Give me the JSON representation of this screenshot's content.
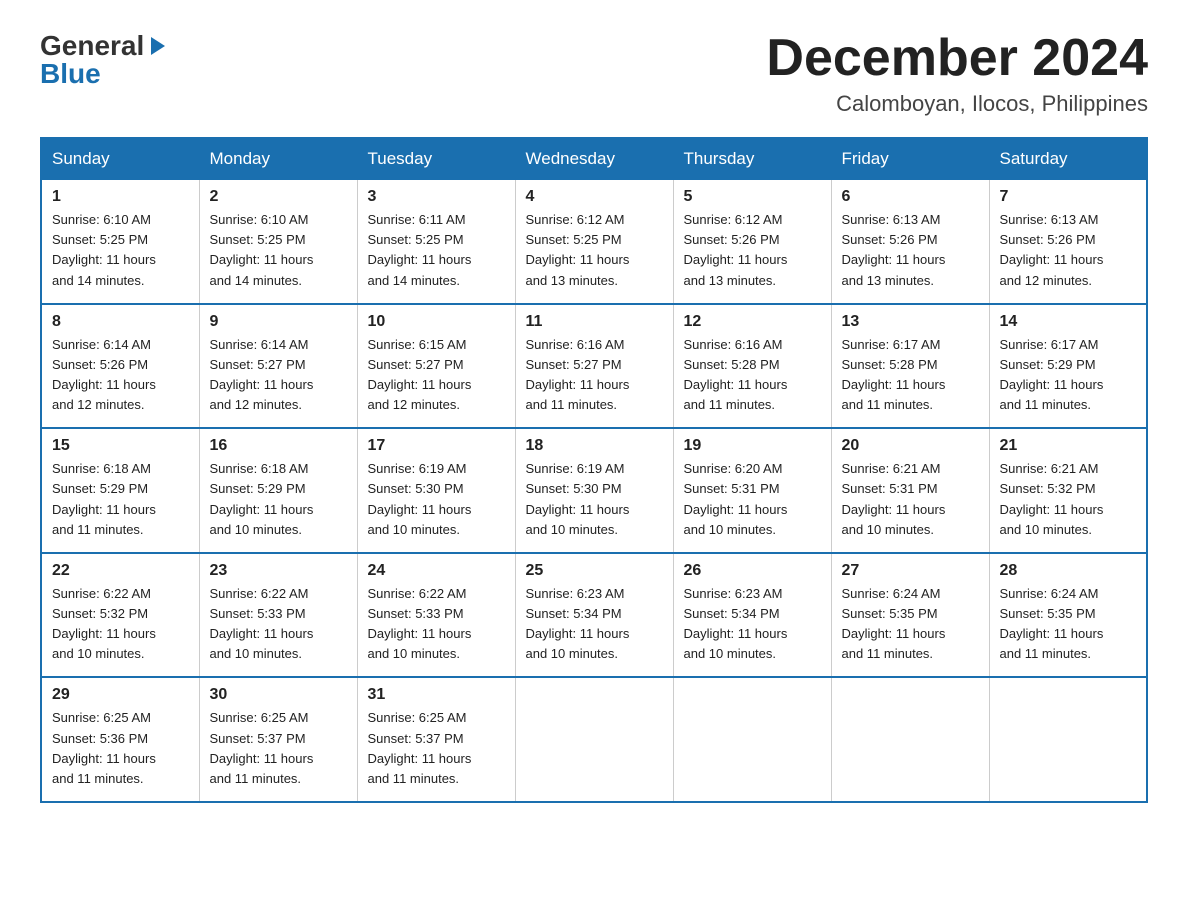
{
  "header": {
    "logo": {
      "general": "General",
      "arrow": "▶",
      "blue": "Blue"
    },
    "title": "December 2024",
    "location": "Calomboyan, Ilocos, Philippines"
  },
  "calendar": {
    "days_of_week": [
      "Sunday",
      "Monday",
      "Tuesday",
      "Wednesday",
      "Thursday",
      "Friday",
      "Saturday"
    ],
    "weeks": [
      [
        {
          "day": "1",
          "sunrise": "6:10 AM",
          "sunset": "5:25 PM",
          "daylight": "11 hours and 14 minutes."
        },
        {
          "day": "2",
          "sunrise": "6:10 AM",
          "sunset": "5:25 PM",
          "daylight": "11 hours and 14 minutes."
        },
        {
          "day": "3",
          "sunrise": "6:11 AM",
          "sunset": "5:25 PM",
          "daylight": "11 hours and 14 minutes."
        },
        {
          "day": "4",
          "sunrise": "6:12 AM",
          "sunset": "5:25 PM",
          "daylight": "11 hours and 13 minutes."
        },
        {
          "day": "5",
          "sunrise": "6:12 AM",
          "sunset": "5:26 PM",
          "daylight": "11 hours and 13 minutes."
        },
        {
          "day": "6",
          "sunrise": "6:13 AM",
          "sunset": "5:26 PM",
          "daylight": "11 hours and 13 minutes."
        },
        {
          "day": "7",
          "sunrise": "6:13 AM",
          "sunset": "5:26 PM",
          "daylight": "11 hours and 12 minutes."
        }
      ],
      [
        {
          "day": "8",
          "sunrise": "6:14 AM",
          "sunset": "5:26 PM",
          "daylight": "11 hours and 12 minutes."
        },
        {
          "day": "9",
          "sunrise": "6:14 AM",
          "sunset": "5:27 PM",
          "daylight": "11 hours and 12 minutes."
        },
        {
          "day": "10",
          "sunrise": "6:15 AM",
          "sunset": "5:27 PM",
          "daylight": "11 hours and 12 minutes."
        },
        {
          "day": "11",
          "sunrise": "6:16 AM",
          "sunset": "5:27 PM",
          "daylight": "11 hours and 11 minutes."
        },
        {
          "day": "12",
          "sunrise": "6:16 AM",
          "sunset": "5:28 PM",
          "daylight": "11 hours and 11 minutes."
        },
        {
          "day": "13",
          "sunrise": "6:17 AM",
          "sunset": "5:28 PM",
          "daylight": "11 hours and 11 minutes."
        },
        {
          "day": "14",
          "sunrise": "6:17 AM",
          "sunset": "5:29 PM",
          "daylight": "11 hours and 11 minutes."
        }
      ],
      [
        {
          "day": "15",
          "sunrise": "6:18 AM",
          "sunset": "5:29 PM",
          "daylight": "11 hours and 11 minutes."
        },
        {
          "day": "16",
          "sunrise": "6:18 AM",
          "sunset": "5:29 PM",
          "daylight": "11 hours and 10 minutes."
        },
        {
          "day": "17",
          "sunrise": "6:19 AM",
          "sunset": "5:30 PM",
          "daylight": "11 hours and 10 minutes."
        },
        {
          "day": "18",
          "sunrise": "6:19 AM",
          "sunset": "5:30 PM",
          "daylight": "11 hours and 10 minutes."
        },
        {
          "day": "19",
          "sunrise": "6:20 AM",
          "sunset": "5:31 PM",
          "daylight": "11 hours and 10 minutes."
        },
        {
          "day": "20",
          "sunrise": "6:21 AM",
          "sunset": "5:31 PM",
          "daylight": "11 hours and 10 minutes."
        },
        {
          "day": "21",
          "sunrise": "6:21 AM",
          "sunset": "5:32 PM",
          "daylight": "11 hours and 10 minutes."
        }
      ],
      [
        {
          "day": "22",
          "sunrise": "6:22 AM",
          "sunset": "5:32 PM",
          "daylight": "11 hours and 10 minutes."
        },
        {
          "day": "23",
          "sunrise": "6:22 AM",
          "sunset": "5:33 PM",
          "daylight": "11 hours and 10 minutes."
        },
        {
          "day": "24",
          "sunrise": "6:22 AM",
          "sunset": "5:33 PM",
          "daylight": "11 hours and 10 minutes."
        },
        {
          "day": "25",
          "sunrise": "6:23 AM",
          "sunset": "5:34 PM",
          "daylight": "11 hours and 10 minutes."
        },
        {
          "day": "26",
          "sunrise": "6:23 AM",
          "sunset": "5:34 PM",
          "daylight": "11 hours and 10 minutes."
        },
        {
          "day": "27",
          "sunrise": "6:24 AM",
          "sunset": "5:35 PM",
          "daylight": "11 hours and 11 minutes."
        },
        {
          "day": "28",
          "sunrise": "6:24 AM",
          "sunset": "5:35 PM",
          "daylight": "11 hours and 11 minutes."
        }
      ],
      [
        {
          "day": "29",
          "sunrise": "6:25 AM",
          "sunset": "5:36 PM",
          "daylight": "11 hours and 11 minutes."
        },
        {
          "day": "30",
          "sunrise": "6:25 AM",
          "sunset": "5:37 PM",
          "daylight": "11 hours and 11 minutes."
        },
        {
          "day": "31",
          "sunrise": "6:25 AM",
          "sunset": "5:37 PM",
          "daylight": "11 hours and 11 minutes."
        },
        null,
        null,
        null,
        null
      ]
    ],
    "labels": {
      "sunrise": "Sunrise:",
      "sunset": "Sunset:",
      "daylight": "Daylight:"
    }
  }
}
